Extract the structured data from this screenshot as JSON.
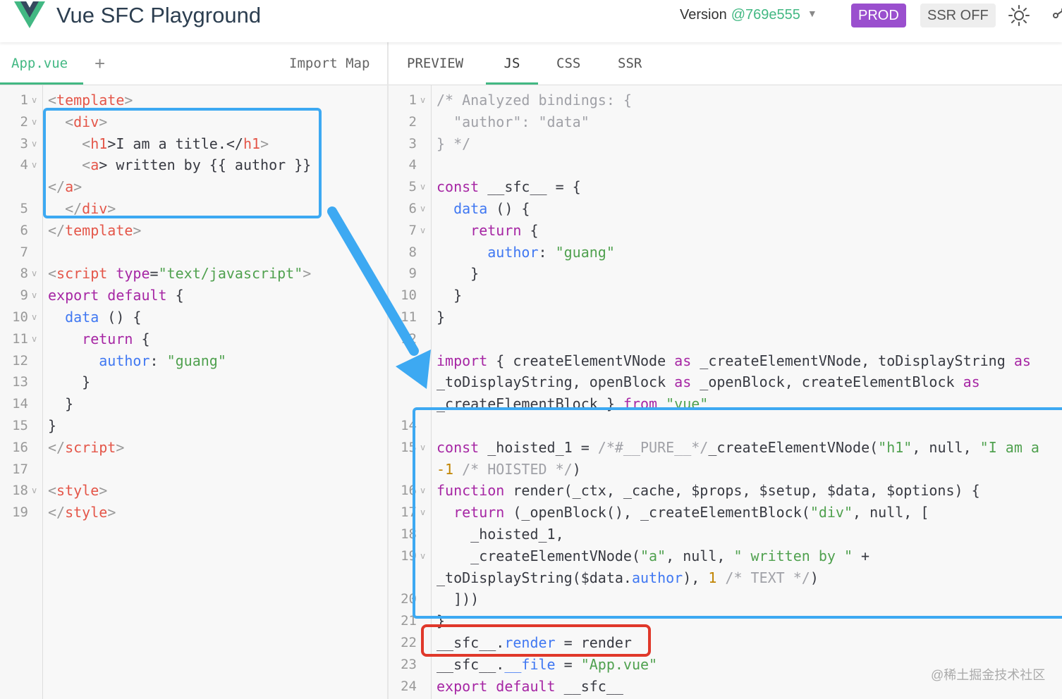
{
  "header": {
    "title": "Vue SFC Playground",
    "version_label": "Version",
    "version_hash": "@769e555",
    "prod_label": "PROD",
    "ssr_label": "SSR OFF"
  },
  "colors": {
    "accent": "#42b883",
    "prod": "#9a4fce",
    "annotation_blue": "#3da9f2",
    "annotation_red": "#e0382a"
  },
  "icons": [
    "vue-logo",
    "chevron-down-icon",
    "sun-icon",
    "share-icon"
  ],
  "editor": {
    "active_file": "App.vue",
    "add_label": "+",
    "import_map_label": "Import Map",
    "lines": [
      {
        "n": "1",
        "fold": true,
        "parts": [
          [
            "<",
            "g"
          ],
          [
            "template",
            "t"
          ],
          [
            ">",
            "g"
          ]
        ]
      },
      {
        "n": "2",
        "fold": true,
        "parts": [
          [
            "  <",
            "g"
          ],
          [
            "div",
            "t"
          ],
          [
            ">",
            "g"
          ]
        ]
      },
      {
        "n": "3",
        "fold": true,
        "parts": [
          [
            "    <",
            "g"
          ],
          [
            "h1",
            "t"
          ],
          [
            ">I am a title.</",
            ""
          ],
          [
            "h1",
            "t"
          ],
          [
            ">",
            "g"
          ]
        ]
      },
      {
        "n": "4",
        "fold": true,
        "parts": [
          [
            "    <",
            "g"
          ],
          [
            "a",
            "t"
          ],
          [
            "> written by {{ author }}",
            ""
          ]
        ]
      },
      {
        "n": "",
        "fold": false,
        "parts": [
          [
            "</",
            "g"
          ],
          [
            "a",
            "t"
          ],
          [
            ">",
            "g"
          ]
        ]
      },
      {
        "n": "5",
        "fold": false,
        "parts": [
          [
            "  </",
            "g"
          ],
          [
            "div",
            "t"
          ],
          [
            ">",
            "g"
          ]
        ]
      },
      {
        "n": "6",
        "fold": false,
        "parts": [
          [
            "</",
            "g"
          ],
          [
            "template",
            "t"
          ],
          [
            ">",
            "g"
          ]
        ]
      },
      {
        "n": "7",
        "fold": false,
        "parts": []
      },
      {
        "n": "8",
        "fold": true,
        "parts": [
          [
            "<",
            "g"
          ],
          [
            "script",
            "t"
          ],
          [
            " ",
            ""
          ],
          [
            "type",
            "k"
          ],
          [
            "=",
            ""
          ],
          [
            "\"text/javascript\"",
            "s"
          ],
          [
            ">",
            "g"
          ]
        ]
      },
      {
        "n": "9",
        "fold": true,
        "parts": [
          [
            "export default",
            "k"
          ],
          [
            " {",
            ""
          ]
        ]
      },
      {
        "n": "10",
        "fold": true,
        "parts": [
          [
            "  data",
            "p"
          ],
          [
            " () {",
            ""
          ]
        ]
      },
      {
        "n": "11",
        "fold": true,
        "parts": [
          [
            "    return",
            "k"
          ],
          [
            " {",
            ""
          ]
        ]
      },
      {
        "n": "12",
        "fold": false,
        "parts": [
          [
            "      author",
            "p"
          ],
          [
            ": ",
            ""
          ],
          [
            "\"guang\"",
            "s"
          ]
        ]
      },
      {
        "n": "13",
        "fold": false,
        "parts": [
          [
            "    }",
            ""
          ]
        ]
      },
      {
        "n": "14",
        "fold": false,
        "parts": [
          [
            "  }",
            ""
          ]
        ]
      },
      {
        "n": "15",
        "fold": false,
        "parts": [
          [
            "}",
            ""
          ]
        ]
      },
      {
        "n": "16",
        "fold": false,
        "parts": [
          [
            "</",
            "g"
          ],
          [
            "script",
            "t"
          ],
          [
            ">",
            "g"
          ]
        ]
      },
      {
        "n": "17",
        "fold": false,
        "parts": []
      },
      {
        "n": "18",
        "fold": true,
        "parts": [
          [
            "<",
            "g"
          ],
          [
            "style",
            "t"
          ],
          [
            ">",
            "g"
          ]
        ]
      },
      {
        "n": "19",
        "fold": false,
        "parts": [
          [
            "</",
            "g"
          ],
          [
            "style",
            "t"
          ],
          [
            ">",
            "g"
          ]
        ]
      }
    ]
  },
  "output": {
    "tabs": [
      "PREVIEW",
      "JS",
      "CSS",
      "SSR"
    ],
    "active_tab": "JS",
    "lines": [
      {
        "n": "1",
        "fold": true,
        "parts": [
          [
            "/* Analyzed bindings: {",
            "c"
          ]
        ]
      },
      {
        "n": "2",
        "fold": false,
        "parts": [
          [
            "  \"author\": \"data\"",
            "c"
          ]
        ]
      },
      {
        "n": "3",
        "fold": false,
        "parts": [
          [
            "} */",
            "c"
          ]
        ]
      },
      {
        "n": "4",
        "fold": false,
        "parts": []
      },
      {
        "n": "5",
        "fold": true,
        "parts": [
          [
            "const",
            "k"
          ],
          [
            " __sfc__ = {",
            ""
          ]
        ]
      },
      {
        "n": "6",
        "fold": true,
        "parts": [
          [
            "  data",
            "p"
          ],
          [
            " () {",
            ""
          ]
        ]
      },
      {
        "n": "7",
        "fold": true,
        "parts": [
          [
            "    return",
            "k"
          ],
          [
            " {",
            ""
          ]
        ]
      },
      {
        "n": "8",
        "fold": false,
        "parts": [
          [
            "      author",
            "p"
          ],
          [
            ": ",
            ""
          ],
          [
            "\"guang\"",
            "s"
          ]
        ]
      },
      {
        "n": "9",
        "fold": false,
        "parts": [
          [
            "    }",
            ""
          ]
        ]
      },
      {
        "n": "10",
        "fold": false,
        "parts": [
          [
            "  }",
            ""
          ]
        ]
      },
      {
        "n": "11",
        "fold": false,
        "parts": [
          [
            "}",
            ""
          ]
        ]
      },
      {
        "n": "12",
        "fold": false,
        "parts": []
      },
      {
        "n": "",
        "fold": false,
        "parts": [
          [
            "import",
            "k"
          ],
          [
            " { createElementVNode ",
            ""
          ],
          [
            "as",
            "k"
          ],
          [
            " _createElementVNode, toDisplayString ",
            ""
          ],
          [
            "as",
            "k"
          ]
        ]
      },
      {
        "n": "",
        "fold": false,
        "parts": [
          [
            "_toDisplayString, openBlock ",
            ""
          ],
          [
            "as",
            "k"
          ],
          [
            " _openBlock, createElementBlock ",
            ""
          ],
          [
            "as",
            "k"
          ]
        ]
      },
      {
        "n": "",
        "fold": false,
        "parts": [
          [
            "_createElementBlock } ",
            ""
          ],
          [
            "from",
            "k"
          ],
          [
            " ",
            ""
          ],
          [
            "\"vue\"",
            "s"
          ]
        ]
      },
      {
        "n": "14",
        "fold": false,
        "parts": []
      },
      {
        "n": "15",
        "fold": true,
        "parts": [
          [
            "const",
            "k"
          ],
          [
            " _hoisted_1 = ",
            ""
          ],
          [
            "/*#__PURE__*/",
            "c"
          ],
          [
            "_createElementVNode(",
            ""
          ],
          [
            "\"h1\"",
            "s"
          ],
          [
            ", null, ",
            ""
          ],
          [
            "\"I am a",
            "s"
          ]
        ]
      },
      {
        "n": "",
        "fold": false,
        "parts": [
          [
            "-1",
            "n"
          ],
          [
            " ",
            ""
          ],
          [
            "/* HOISTED */",
            "c"
          ],
          [
            ")",
            ""
          ]
        ]
      },
      {
        "n": "16",
        "fold": true,
        "parts": [
          [
            "function",
            "k"
          ],
          [
            " render(_ctx, _cache, $props, $setup, $data, $options) {",
            ""
          ]
        ]
      },
      {
        "n": "17",
        "fold": true,
        "parts": [
          [
            "  return",
            "k"
          ],
          [
            " (_openBlock(), _createElementBlock(",
            ""
          ],
          [
            "\"div\"",
            "s"
          ],
          [
            ", null, [",
            ""
          ]
        ]
      },
      {
        "n": "18",
        "fold": false,
        "parts": [
          [
            "    _hoisted_1,",
            ""
          ]
        ]
      },
      {
        "n": "19",
        "fold": true,
        "parts": [
          [
            "    _createElementVNode(",
            ""
          ],
          [
            "\"a\"",
            "s"
          ],
          [
            ", null, ",
            ""
          ],
          [
            "\" written by \"",
            "s"
          ],
          [
            " +",
            ""
          ]
        ]
      },
      {
        "n": "",
        "fold": false,
        "parts": [
          [
            "_toDisplayString($data.",
            ""
          ],
          [
            "author",
            "p"
          ],
          [
            "), ",
            ""
          ],
          [
            "1",
            "n"
          ],
          [
            " ",
            ""
          ],
          [
            "/* TEXT */",
            "c"
          ],
          [
            ")",
            ""
          ]
        ]
      },
      {
        "n": "20",
        "fold": false,
        "parts": [
          [
            "  ]))",
            ""
          ]
        ]
      },
      {
        "n": "21",
        "fold": false,
        "parts": [
          [
            "}",
            ""
          ]
        ]
      },
      {
        "n": "22",
        "fold": false,
        "parts": [
          [
            "__sfc__.",
            ""
          ],
          [
            "render",
            "p"
          ],
          [
            " = render",
            ""
          ]
        ]
      },
      {
        "n": "23",
        "fold": false,
        "parts": [
          [
            "__sfc__.",
            ""
          ],
          [
            "__file",
            "p"
          ],
          [
            " = ",
            ""
          ],
          [
            "\"App.vue\"",
            "s"
          ]
        ]
      },
      {
        "n": "24",
        "fold": false,
        "parts": [
          [
            "export default",
            "k"
          ],
          [
            " __sfc__",
            ""
          ]
        ]
      }
    ]
  },
  "watermark": "@稀土掘金技术社区"
}
